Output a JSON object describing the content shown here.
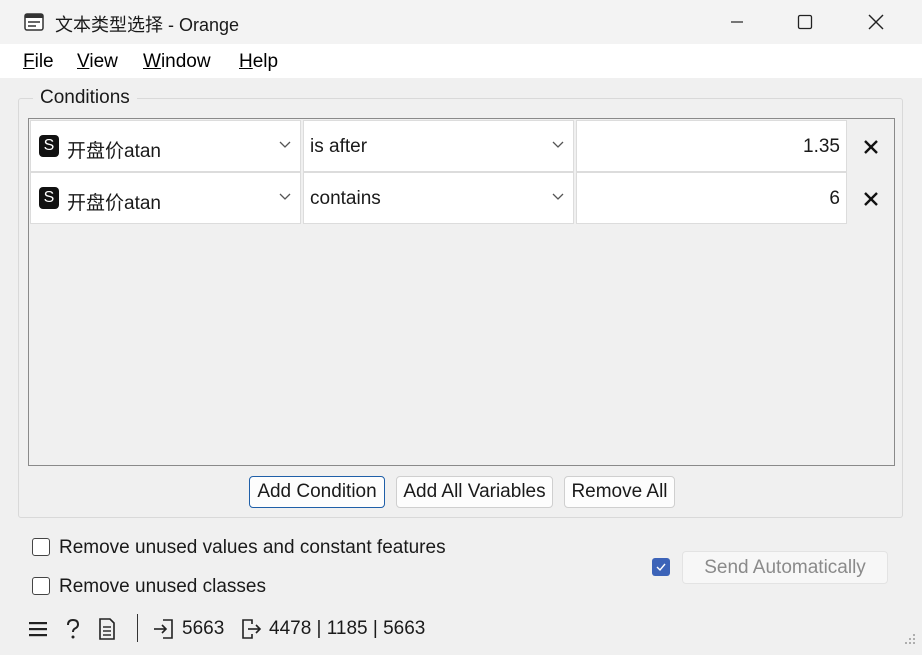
{
  "window": {
    "title": "文本类型选择 - Orange",
    "app_icon": "orange-widget-icon",
    "controls": [
      "minimize-icon",
      "maximize-icon",
      "close-icon"
    ]
  },
  "menu": {
    "file": "File",
    "view": "View",
    "window": "Window",
    "help": "Help"
  },
  "conditions": {
    "group_title": "Conditions",
    "rows": [
      {
        "variable_badge": "S",
        "variable": "开盘价atan",
        "operator": "is after",
        "value": "1.35"
      },
      {
        "variable_badge": "S",
        "variable": "开盘价atan",
        "operator": "contains",
        "value": "6"
      }
    ]
  },
  "buttons": {
    "add_condition": "Add Condition",
    "add_all_variables": "Add All Variables",
    "remove_all": "Remove All"
  },
  "options": {
    "remove_unused_values": {
      "label": "Remove unused values and constant features",
      "checked": false
    },
    "remove_unused_classes": {
      "label": "Remove unused classes",
      "checked": false
    },
    "send_automatically": {
      "label": "Send Automatically",
      "checked": true
    }
  },
  "status": {
    "input_count": "5663",
    "output_counts": "4478 | 1185 | 5663"
  },
  "colors": {
    "accent": "#3c63b8",
    "primary_border": "#1f5fa8",
    "background": "#f0f0f0"
  }
}
